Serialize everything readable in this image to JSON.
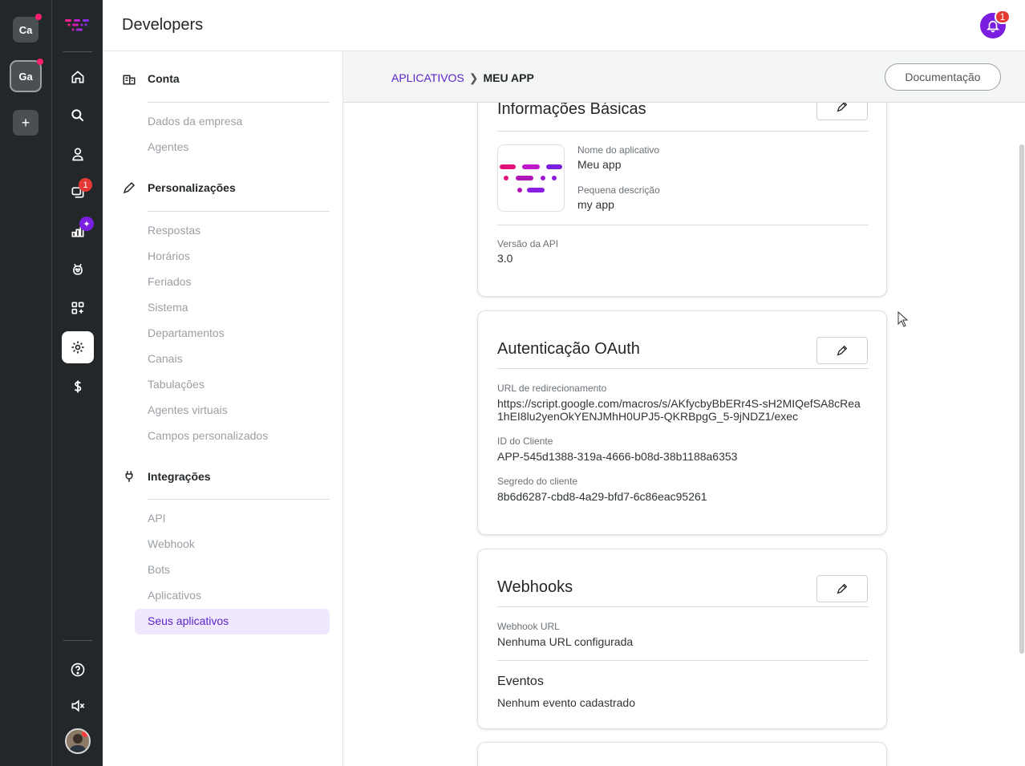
{
  "workspaces": [
    {
      "initials": "Ca"
    },
    {
      "initials": "Ga"
    },
    {
      "initials": "+"
    }
  ],
  "nav": {
    "chat_badge": "1",
    "spark_glyph": "✦"
  },
  "topbar": {
    "title": "Developers",
    "notification_count": "1"
  },
  "settings": {
    "sections": [
      {
        "title": "Conta",
        "items": [
          "Dados da empresa",
          "Agentes"
        ]
      },
      {
        "title": "Personalizações",
        "items": [
          "Respostas",
          "Horários",
          "Feriados",
          "Sistema",
          "Departamentos",
          "Canais",
          "Tabulações",
          "Agentes virtuais",
          "Campos personalizados"
        ]
      },
      {
        "title": "Integrações",
        "items": [
          "API",
          "Webhook",
          "Bots",
          "Aplicativos",
          "Seus aplicativos"
        ]
      }
    ]
  },
  "header": {
    "crumb_parent": "APLICATIVOS",
    "crumb_sep": "❯",
    "crumb_current": "MEU APP",
    "doc_button": "Documentação"
  },
  "basic": {
    "title": "Informações Básicas",
    "name_label": "Nome do aplicativo",
    "name_value": "Meu app",
    "desc_label": "Pequena descrição",
    "desc_value": "my app",
    "api_label": "Versão da API",
    "api_value": "3.0"
  },
  "oauth": {
    "title": "Autenticação OAuth",
    "redirect_label": "URL de redirecionamento",
    "redirect_value_1": "https://script.google.com/macros/s/AKfycbyBbERr4S-sH2MIQefSA8cRea",
    "redirect_value_2": "1hEI8lu2yenOkYENJMhH0UPJ5-QKRBpgG_5-9jNDZ1/exec",
    "client_id_label": "ID do Cliente",
    "client_id_value": "APP-545d1388-319a-4666-b08d-38b1188a6353",
    "secret_label": "Segredo do cliente",
    "secret_value": "8b6d6287-cbd8-4a29-bfd7-6c86eac95261"
  },
  "webhooks": {
    "title": "Webhooks",
    "url_label": "Webhook URL",
    "url_value": "Nenhuma URL configurada",
    "events_title": "Eventos",
    "events_value": "Nenhum evento cadastrado"
  },
  "colors": {
    "accent": "#7a1fe0",
    "link": "#5b24c8",
    "rail": "#23272a",
    "badge": "#e53935"
  }
}
